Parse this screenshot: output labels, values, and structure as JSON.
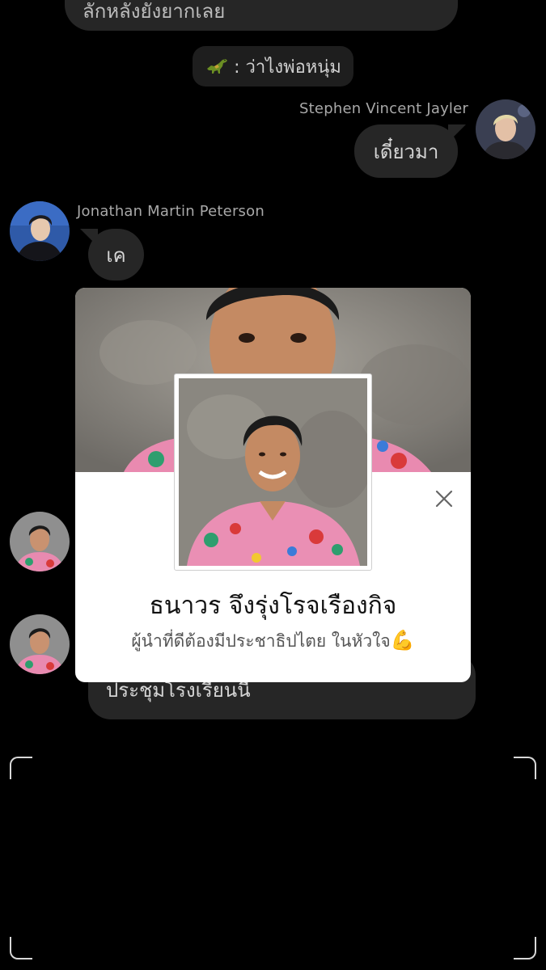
{
  "chat": {
    "top_message": "ลักหลังยังยากเลย",
    "system_message": {
      "icon": "dinosaur-icon",
      "text": ": ว่าไงพ่อหนุ่ม"
    },
    "stephen": {
      "name": "Stephen Vincent Jayler",
      "message": "เดี๋ยวมา"
    },
    "jonathan": {
      "name": "Jonathan Martin Peterson",
      "message": "เค"
    },
    "bottom_message": "ประชุมโรงเรียนนี้"
  },
  "profile_card": {
    "name": "ธนาวร จึงรุ่งโรจเรืองกิจ",
    "bio": "ผู้นำที่ดีต้องมีประชาธิปไตย ในหัวใจ",
    "bio_emoji": "💪",
    "close_icon": "close-icon"
  },
  "colors": {
    "background": "#000000",
    "bubble": "#262626",
    "card": "#ffffff"
  }
}
